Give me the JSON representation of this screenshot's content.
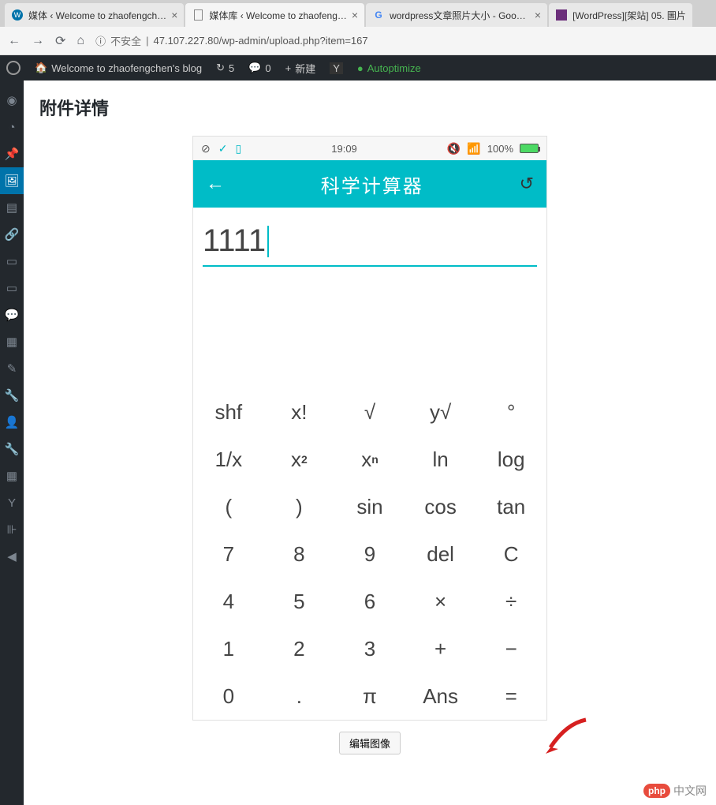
{
  "browser": {
    "tabs": [
      {
        "title": "媒体 ‹ Welcome to zhaofengch…",
        "favicon": "wp"
      },
      {
        "title": "媒体库 ‹ Welcome to zhaofeng…",
        "favicon": "doc",
        "active": true
      },
      {
        "title": "wordpress文章照片大小 - Goog…",
        "favicon": "g"
      },
      {
        "title": "[WordPress][架站] 05. 圖片",
        "favicon": "sq"
      }
    ],
    "insecure_label": "不安全",
    "url": "47.107.227.80/wp-admin/upload.php?item=167"
  },
  "wp_adminbar": {
    "site_name": "Welcome to zhaofengchen's blog",
    "updates": "5",
    "comments": "0",
    "new_label": "新建",
    "autoptimize": "Autoptimize"
  },
  "modal": {
    "title": "附件详情",
    "edit_button": "编辑图像"
  },
  "phone": {
    "statusbar": {
      "time": "19:09",
      "battery_pct": "100%"
    },
    "calc_header": {
      "title": "科学计算器"
    },
    "display_value": "1111",
    "keys": [
      [
        "shf",
        "x!",
        "√",
        "y√",
        "°"
      ],
      [
        "1/x",
        "x²",
        "xⁿ",
        "ln",
        "log"
      ],
      [
        "(",
        ")",
        "sin",
        "cos",
        "tan"
      ],
      [
        "7",
        "8",
        "9",
        "del",
        "C"
      ],
      [
        "4",
        "5",
        "6",
        "×",
        "÷"
      ],
      [
        "1",
        "2",
        "3",
        "+",
        "−"
      ],
      [
        "0",
        ".",
        "π",
        "Ans",
        "="
      ]
    ]
  },
  "watermark": {
    "badge": "php",
    "text": "中文网"
  }
}
